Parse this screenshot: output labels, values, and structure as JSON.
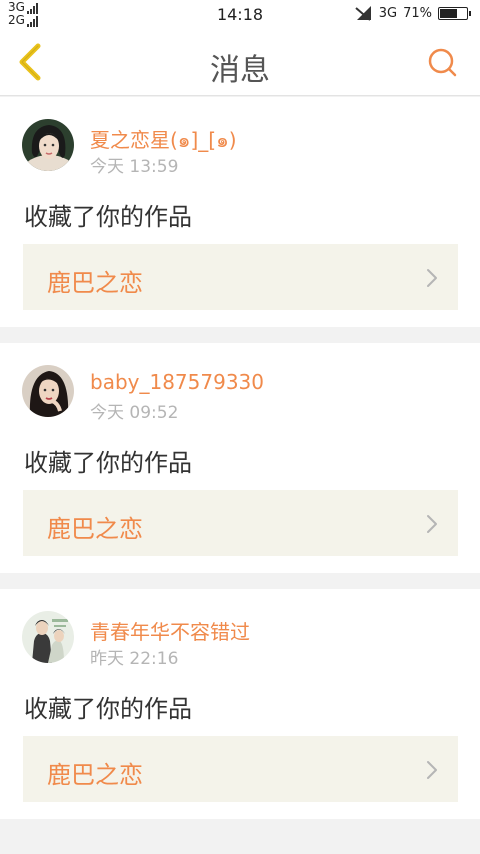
{
  "status_bar": {
    "network_top": "3G",
    "network_bottom": "2G",
    "time": "14:18",
    "mobile_data": "3G",
    "battery_percent": "71%",
    "battery_level": 0.71
  },
  "header": {
    "title": "消息",
    "back_icon": "chevron-left-icon",
    "search_icon": "search-icon"
  },
  "colors": {
    "accent": "#f08a4b",
    "back_icon": "#e9c21a",
    "work_card_bg": "#f4f3ea"
  },
  "messages": [
    {
      "user": "夏之恋星(๑]_[๑)",
      "time": "今天 13:59",
      "action": "收藏了你的作品",
      "work_title": "鹿巴之恋"
    },
    {
      "user": "baby_187579330",
      "time": "今天 09:52",
      "action": "收藏了你的作品",
      "work_title": "鹿巴之恋"
    },
    {
      "user": "青春年华不容错过",
      "time": "昨天 22:16",
      "action": "收藏了你的作品",
      "work_title": "鹿巴之恋"
    }
  ]
}
